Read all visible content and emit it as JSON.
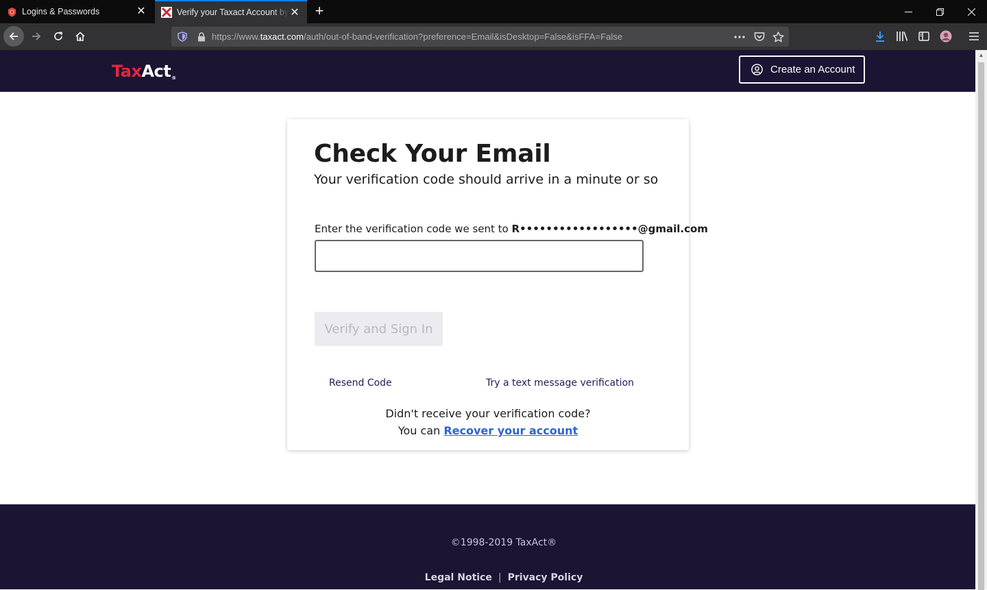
{
  "browser": {
    "tabs": [
      {
        "title": "Logins & Passwords",
        "active": false,
        "icon": "lockwise-icon"
      },
      {
        "title": "Verify your Taxact Account by email",
        "active": true,
        "icon": "taxact-favicon"
      }
    ],
    "url_prefix": "https://www.",
    "url_host": "taxact.com",
    "url_path": "/auth/out-of-band-verification?preference=Email&isDesktop=False&isFFA=False",
    "accent": "#0a84ff"
  },
  "header": {
    "logo_tax": "Tax",
    "logo_act": "Act",
    "logo_mark": "®",
    "create_account_label": "Create an Account",
    "background": "#1b1433"
  },
  "card": {
    "title": "Check Your Email",
    "subtitle": "Your verification code should arrive in a minute or so",
    "label_prefix": "Enter the verification code we sent to ",
    "masked_email": "R••••••••••••••••••@gmail.com",
    "code_value": "",
    "verify_label": "Verify and Sign In",
    "resend_label": "Resend Code",
    "text_verify_label": "Try a text message verification",
    "didnt_receive": "Didn't receive your verification code?",
    "you_can": "You can ",
    "recover_label": "Recover your account"
  },
  "footer": {
    "copyright": "©1998-2019 TaxAct®",
    "legal_notice": "Legal Notice",
    "separator": "|",
    "privacy_policy": "Privacy Policy"
  }
}
